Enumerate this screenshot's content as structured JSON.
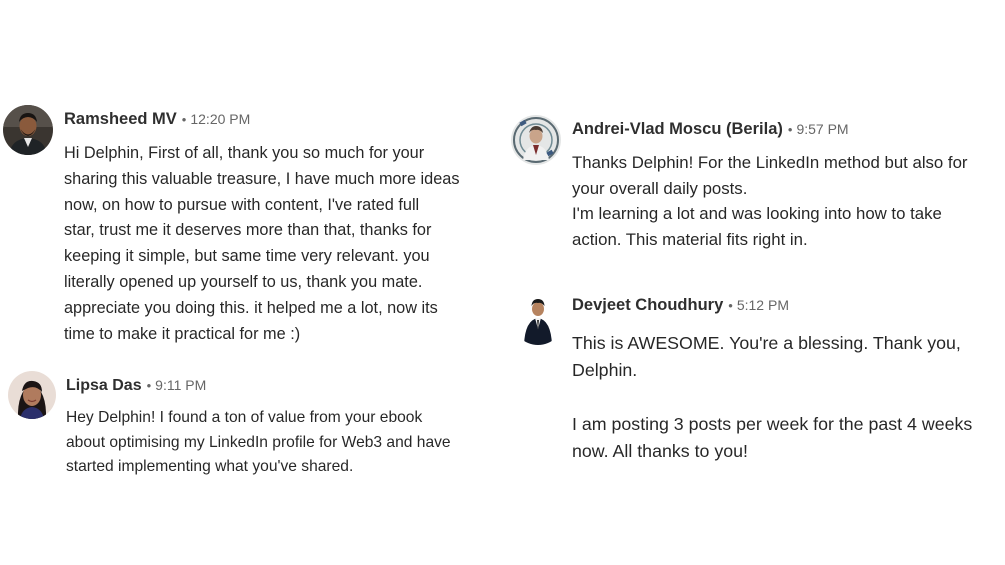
{
  "messages": [
    {
      "name": "Ramsheed MV",
      "time": "12:20 PM",
      "text": "Hi Delphin, First of all, thank you so much for your\nsharing this valuable treasure, I have much more ideas\nnow, on how to pursue with content, I've rated full\nstar, trust me it deserves more than that, thanks for\nkeeping it simple, but same time very relevant. you\nliterally opened up yourself to us, thank you mate.\nappreciate you doing this. it helped me a lot, now its\ntime to make it practical for me :)"
    },
    {
      "name": "Lipsa Das",
      "time": "9:11 PM",
      "text": "Hey Delphin! I found a ton of value from your ebook\nabout optimising my LinkedIn profile for Web3 and have\nstarted implementing what you've shared."
    },
    {
      "name": "Andrei-Vlad Moscu (Berila)",
      "time": "9:57 PM",
      "text": "Thanks Delphin! For the LinkedIn method but also for\nyour overall daily posts.\nI'm learning a lot and was looking into how to take\naction. This material fits right in."
    },
    {
      "name": "Devjeet Choudhury",
      "time": "5:12 PM",
      "text": "This is AWESOME. You're a blessing. Thank you,\nDelphin.\n\nI am posting 3 posts per week for the past 4 weeks\nnow. All thanks to you!"
    }
  ],
  "separator": "•",
  "colors": {
    "name": "#2b2b2b",
    "time": "#666666",
    "body": "#262626",
    "background": "#ffffff"
  },
  "icons": [
    "avatar-photo"
  ]
}
